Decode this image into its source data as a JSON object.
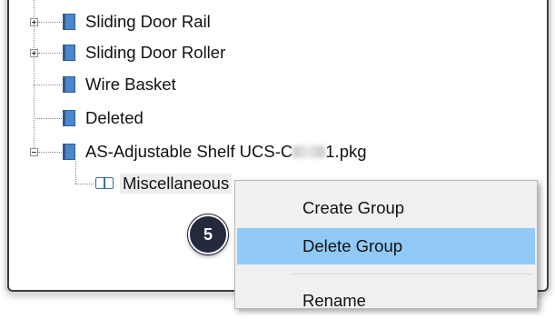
{
  "tree": {
    "items": [
      {
        "label": "Sliding Door Rail",
        "expander": "plus",
        "icon": "blue-book-icon"
      },
      {
        "label": "Sliding Door Roller",
        "expander": "plus",
        "icon": "blue-book-icon"
      },
      {
        "label": "Wire Basket",
        "expander": null,
        "icon": "blue-book-icon"
      },
      {
        "label": "Deleted",
        "expander": null,
        "icon": "blue-book-icon"
      },
      {
        "label_prefix": "AS-Adjustable Shelf UCS-C",
        "label_suffix": "1.pkg",
        "expander": "minus",
        "icon": "blue-book-icon"
      }
    ],
    "child": {
      "label": "Miscellaneous",
      "icon": "open-book-icon",
      "selected": true
    }
  },
  "context_menu": {
    "items": [
      {
        "label": "Create Group"
      },
      {
        "label": "Delete Group",
        "highlighted": true
      },
      {
        "label": "Rename"
      }
    ]
  },
  "step_badge": {
    "number": "5"
  },
  "colors": {
    "highlight": "#91c9f7",
    "book": "#4a86c8",
    "badge": "#242a3e"
  }
}
